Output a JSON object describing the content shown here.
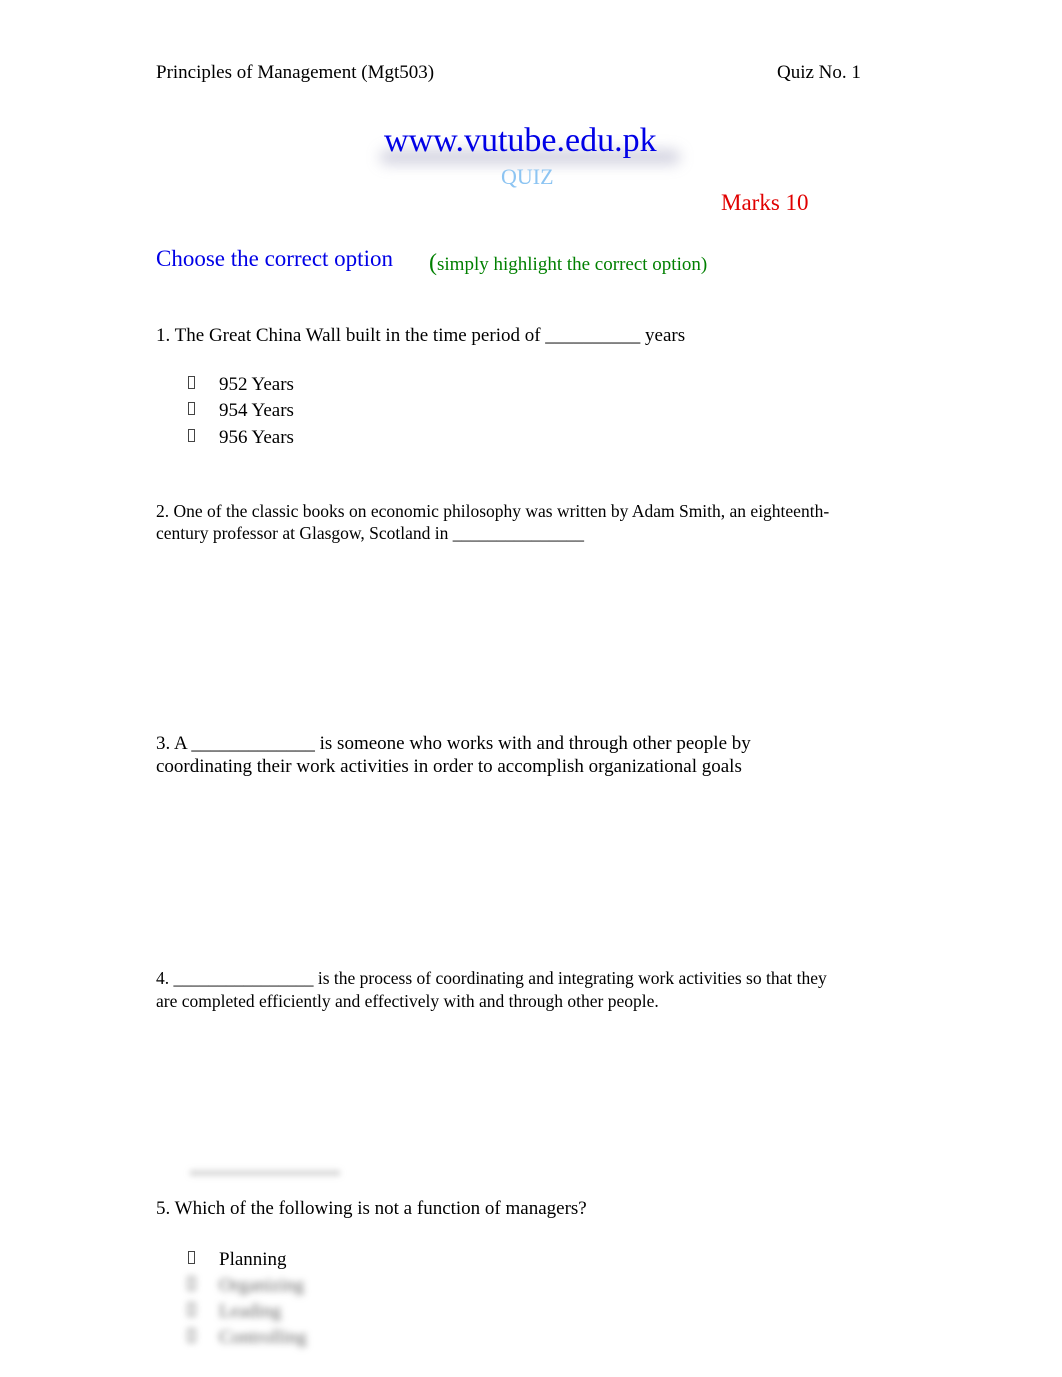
{
  "header": {
    "course": "Principles of Management (Mgt503)",
    "quiz_number": "Quiz No. 1"
  },
  "title": {
    "site": "www.vutube.edu.pk",
    "subtitle": "QUIZ",
    "marks": "Marks 10"
  },
  "instructions": {
    "main": "Choose the correct option",
    "paren_open": "(",
    "hint": "simply highlight the correct option)"
  },
  "questions": [
    {
      "text": "1. The Great China Wall built in the time period of __________ years",
      "options": [
        "952 Years",
        "954 Years",
        "956 Years"
      ]
    },
    {
      "line1": "2. One of the classic books on economic philosophy was written by Adam Smith, an eighteenth-",
      "line2": "century professor at Glasgow, Scotland in _______________"
    },
    {
      "line1": "3. A _____________ is someone who works with and through other people by",
      "line2": "coordinating their work activities in order to accomplish organizational goals"
    },
    {
      "line1": "4. ________________ is the process of coordinating and integrating work activities so that they",
      "line2": "are completed efficiently and effectively with and through other people."
    },
    {
      "text": "5. Which of the following is not a function of managers?",
      "options": [
        "Planning",
        "Organizing",
        "Leading",
        "Controlling"
      ]
    }
  ]
}
